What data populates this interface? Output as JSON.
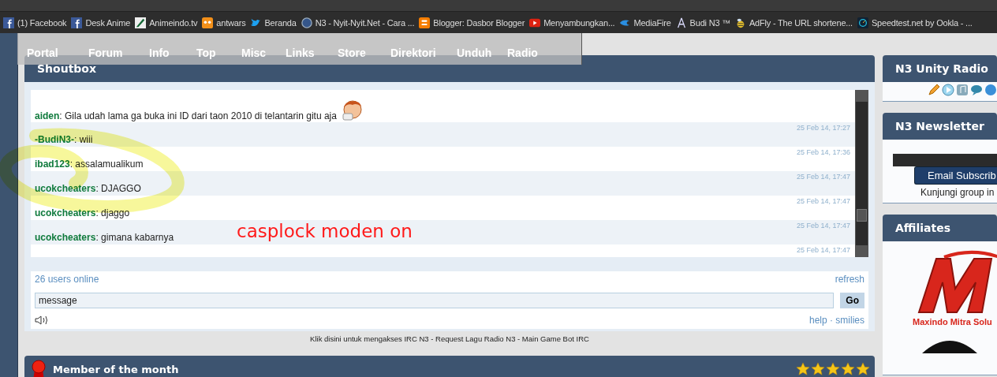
{
  "bookmarks": [
    {
      "label": "(1) Facebook"
    },
    {
      "label": "Desk Anime"
    },
    {
      "label": "Animeindo.tv"
    },
    {
      "label": "antwars"
    },
    {
      "label": "Beranda"
    },
    {
      "label": "N3 - Nyit-Nyit.Net - Cara ..."
    },
    {
      "label": "Blogger: Dasbor Blogger"
    },
    {
      "label": "Menyambungkan..."
    },
    {
      "label": "MediaFire"
    },
    {
      "label": "Budi N3 ™"
    },
    {
      "label": "AdFly - The URL shortene..."
    },
    {
      "label": "Speedtest.net by Ookla - ..."
    }
  ],
  "nav": [
    "Portal",
    "Forum",
    "Info",
    "Top",
    "Misc",
    "Links",
    "Store",
    "Direktori",
    "Unduh",
    "Radio"
  ],
  "shoutbox": {
    "title": "Shoutbox",
    "messages": [
      {
        "text": "**aiden**: Gila udah lama ga buka ini ID dari taon 2010 di telantarin gitu aja",
        "emoticon": true
      },
      {
        "time": "25 Feb 14, 17:27",
        "text": "**-BudiN3-**: wiii",
        "emoticon": false
      },
      {
        "time": "25 Feb 14, 17:36",
        "text": "**ibad123**: assalamualikum",
        "emoticon": false
      },
      {
        "time": "25 Feb 14, 17:47",
        "text": "**ucokcheaters**: DJAGGO",
        "emoticon": false
      },
      {
        "time": "25 Feb 14, 17:47",
        "text": "**ucokcheaters**: djaggo",
        "emoticon": false
      },
      {
        "time": "25 Feb 14, 17:47",
        "text": "**ucokcheaters**: gimana kabarnya",
        "emoticon": false
      },
      {
        "time": "25 Feb 14, 17:47",
        "emoticon": false
      }
    ],
    "online": "26 users online",
    "refresh": "refresh",
    "input": {
      "value": "message"
    },
    "go": "Go",
    "links": [
      "help",
      "smilies"
    ],
    "separator": "·",
    "footer": "Klik disini untuk mengakses IRC N3 - Request Lagu Radio N3 - Main Game Bot IRC"
  },
  "annotation": {
    "text": "casplock moden on"
  },
  "member": {
    "title": "Member of the month",
    "stars": 5
  },
  "sidebar": {
    "radio": {
      "title": "N3 Unity Radio"
    },
    "newsletter": {
      "title": "N3 Newsletter",
      "button": "Email Subscrib",
      "note": "Kunjungi group in"
    },
    "affiliates": {
      "title": "Affiliates",
      "logo_text": "Maxindo Mitra Solu"
    }
  }
}
